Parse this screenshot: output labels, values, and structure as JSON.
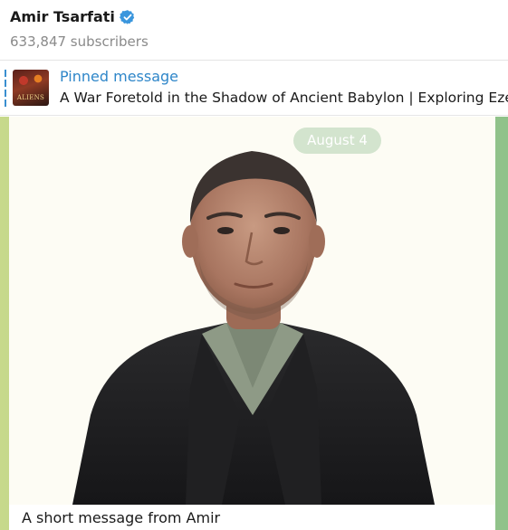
{
  "header": {
    "title": "Amir Tsarfati",
    "subscribers": "633,847 subscribers",
    "verified_icon": "verified-badge-icon"
  },
  "pinned": {
    "label": "Pinned message",
    "text": "A War Foretold in the Shadow of Ancient Babylon | Exploring Ezek",
    "thumbnail_text": "ALIENS"
  },
  "message": {
    "date": "August 4",
    "caption": "A short message from Amir"
  },
  "colors": {
    "accent": "#2e86c9",
    "verified": "#3a96dd"
  }
}
